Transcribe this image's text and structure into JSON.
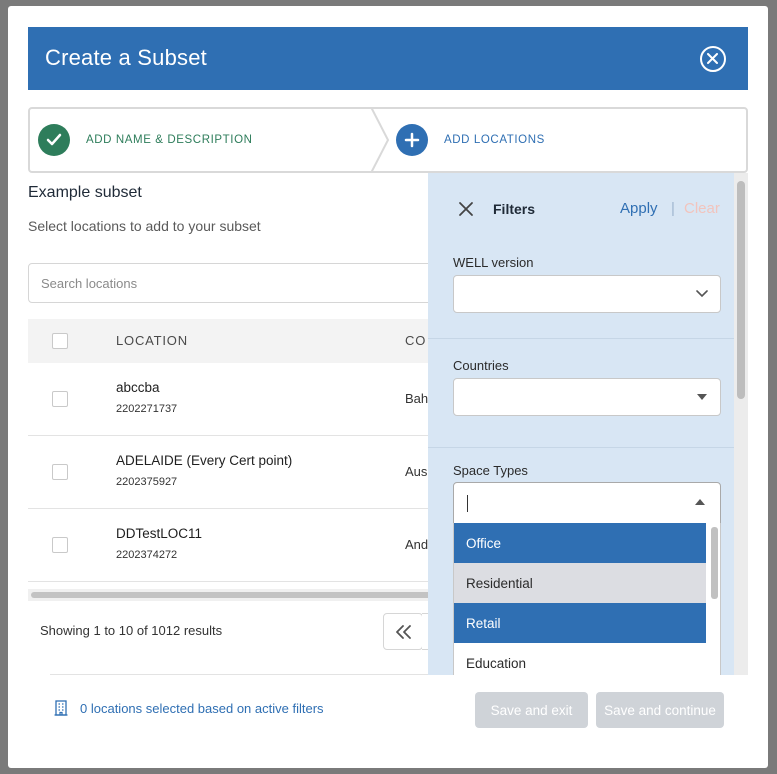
{
  "modal": {
    "title": "Create a Subset"
  },
  "stepper": {
    "steps": [
      {
        "label": "ADD NAME & DESCRIPTION",
        "status": "complete",
        "icon": "checkmark-icon"
      },
      {
        "label": "ADD LOCATIONS",
        "status": "active",
        "icon": "plus-icon"
      }
    ]
  },
  "content": {
    "title": "Example subset",
    "subtitle": "Select locations to add to your subset",
    "search_placeholder": "Search locations"
  },
  "table": {
    "columns": [
      "LOCATION",
      "CO"
    ],
    "rows": [
      {
        "name": "abccba",
        "id": "2202271737",
        "country": "Bah"
      },
      {
        "name": "ADELAIDE (Every Cert point)",
        "id": "2202375927",
        "country": "Aus"
      },
      {
        "name": "DDTestLOC11",
        "id": "2202374272",
        "country": "And"
      }
    ]
  },
  "pagination": {
    "showing": "Showing 1 to 10 of 1012 results",
    "first_icon": "double-chevron-left-icon"
  },
  "footer": {
    "info": "0 locations selected based on active filters",
    "info_icon": "building-icon",
    "save_exit": "Save and exit",
    "save_continue": "Save and continue"
  },
  "filters": {
    "title": "Filters",
    "apply": "Apply",
    "separator": "|",
    "clear": "Clear",
    "well_version_label": "WELL version",
    "countries_label": "Countries",
    "space_types_label": "Space Types",
    "space_type_options": [
      {
        "label": "Office",
        "state": "selected"
      },
      {
        "label": "Residential",
        "state": "hover"
      },
      {
        "label": "Retail",
        "state": "selected"
      },
      {
        "label": "Education",
        "state": "plain"
      }
    ]
  },
  "colors": {
    "primary": "#2f6fb3",
    "success": "#2e7d5b",
    "panel_bg": "#d8e6f4",
    "disabled_btn": "#cfd3d8"
  }
}
